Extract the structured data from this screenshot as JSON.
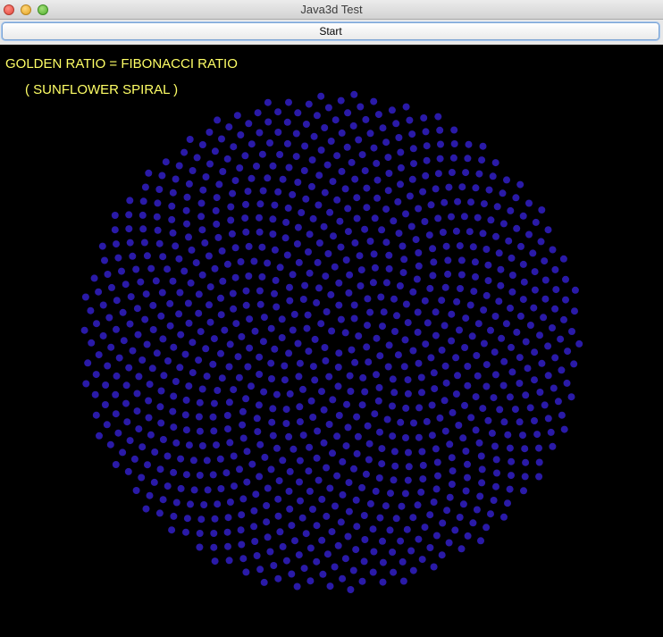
{
  "window": {
    "title": "Java3d Test"
  },
  "toolbar": {
    "start_label": "Start"
  },
  "canvas": {
    "line1": "GOLDEN RATIO = FIBONACCI RATIO",
    "line2": "( SUNFLOWER SPIRAL )",
    "background_color": "#000000",
    "text_color": "#ffff66",
    "dot_color": "#2a1aa8"
  },
  "spiral": {
    "pattern": "golden-angle phyllotaxis",
    "golden_angle_degrees": 137.508,
    "dot_count": 1000
  }
}
